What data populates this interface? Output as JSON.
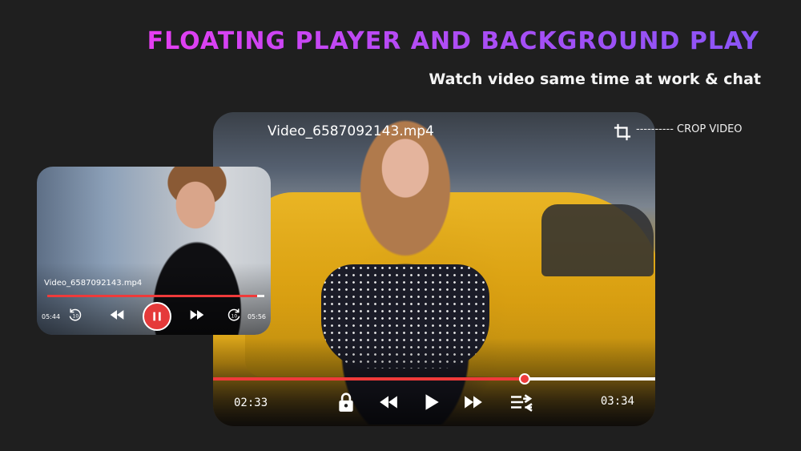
{
  "header": {
    "title": "FLOATING PLAYER AND BACKGROUND PLAY",
    "subtitle": "Watch video same time at work & chat"
  },
  "main_player": {
    "title": "Video_6587092143.mp4",
    "crop_label": "---------- CROP VIDEO",
    "current_time": "02:33",
    "total_time": "03:34",
    "progress": 0.705,
    "controls": [
      "lock-icon",
      "rewind-icon",
      "play-icon",
      "fast-forward-icon",
      "playlist-icon"
    ],
    "colors": {
      "progress": "#ef3a3a",
      "track": "#ffffff"
    }
  },
  "mini_player": {
    "title": "Video_6587092143.mp4",
    "current_time": "05:44",
    "total_time": "05:56",
    "progress": 0.965,
    "controls": [
      "replay-10-icon",
      "rewind-icon",
      "pause-icon",
      "fast-forward-icon",
      "forward-10-icon"
    ],
    "colors": {
      "pause_button": "#e53a3a"
    }
  }
}
